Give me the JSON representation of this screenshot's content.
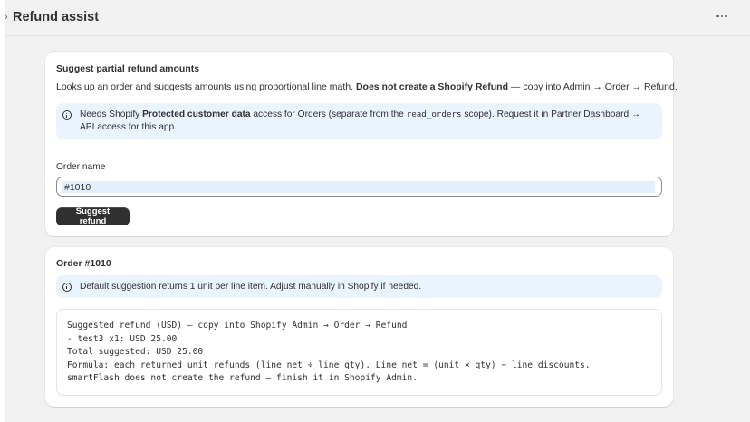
{
  "header": {
    "title": "Refund assist",
    "chevron": "›",
    "more_icon": "more-horizontal-icon"
  },
  "card1": {
    "title": "Suggest partial refund amounts",
    "desc_prefix": "Looks up an order and suggests amounts using proportional line math. ",
    "desc_bold": "Does not create a Shopify Refund",
    "desc_suffix": " — copy into Admin → Order → Refund.",
    "banner": {
      "icon": "info-icon",
      "text_1": "Needs Shopify ",
      "text_bold": "Protected customer data",
      "text_2": " access for Orders (separate from the ",
      "code": "read_orders",
      "text_3": " scope). Request it in Partner Dashboard → API access for this app."
    },
    "field_label": "Order name",
    "field_value": "#1010",
    "button_label": "Suggest refund"
  },
  "card2": {
    "title": "Order #1010",
    "banner": {
      "icon": "info-icon",
      "text": "Default suggestion returns 1 unit per line item. Adjust manually in Shopify if needed."
    },
    "output_lines": [
      "Suggested refund (USD) — copy into Shopify Admin → Order → Refund",
      "- test3 x1: USD 25.00",
      "Total suggested: USD 25.00",
      "Formula: each returned unit refunds (line net ÷ line qty). Line net = (unit × qty) − line discounts.",
      "smartFlash does not create the refund — finish it in Shopify Admin."
    ]
  },
  "colors": {
    "background": "#f1f1f1",
    "card": "#ffffff",
    "banner": "#eaf4ff",
    "button": "#303030",
    "text": "#303030"
  }
}
